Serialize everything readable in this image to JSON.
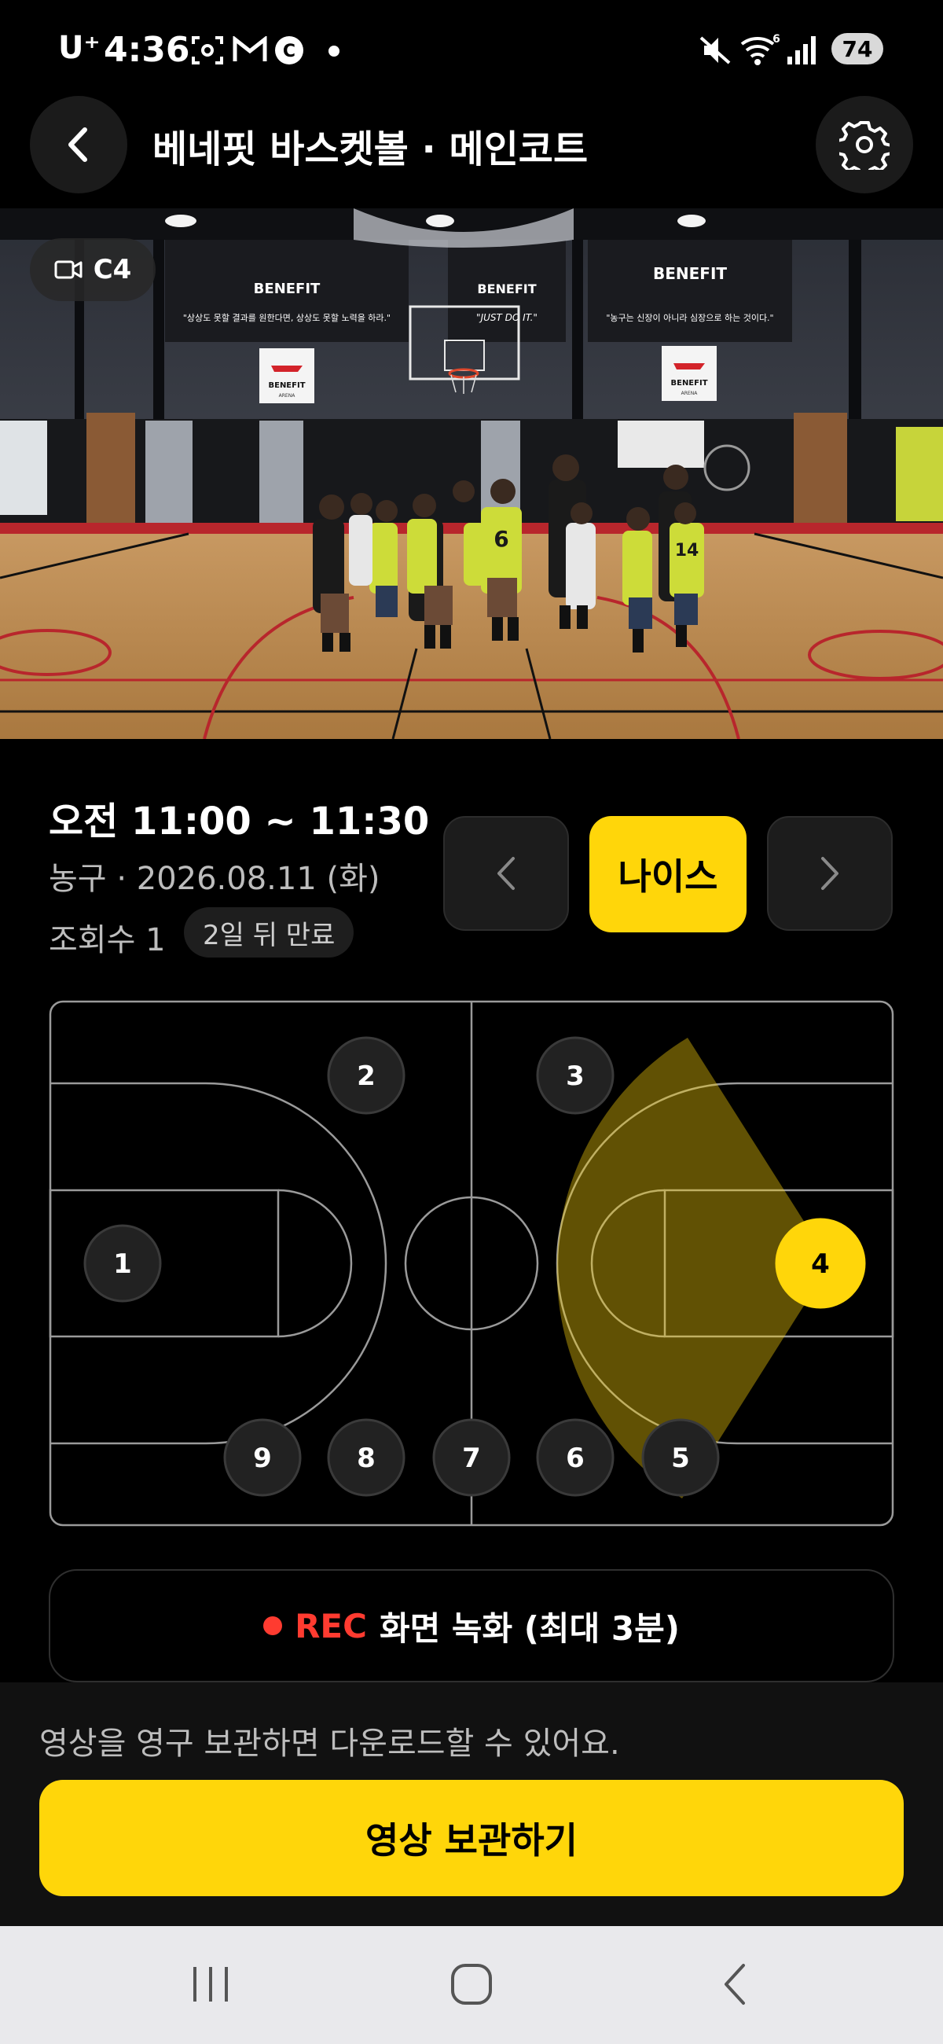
{
  "status_bar": {
    "carrier": "U⁺",
    "time": "4:36",
    "battery": "74",
    "icons": [
      "screenshot-icon",
      "gmail-icon",
      "c-app-icon",
      "dot-icon",
      "mute-icon",
      "wifi-icon",
      "signal-icon"
    ],
    "wifi_badge": "6"
  },
  "header": {
    "title": "베네핏 바스켓볼 · 메인코트",
    "back_icon": "back-arrow-icon",
    "settings_icon": "gear-icon"
  },
  "video": {
    "camera_label": "C4",
    "camera_icon": "video-camera-icon",
    "banners": [
      "\"상상도 못할 결과를 원한다면, 상상도 못할 노력을 하라.\"",
      "\"JUST DO IT.\"",
      "\"농구는 신장이 아니라 심장으로 하는 것이다.\""
    ],
    "brand": "BENEFIT",
    "brand_sub": "ARENA",
    "jersey_numbers": [
      "6",
      "14"
    ]
  },
  "info": {
    "time_range": "오전 11:00 ~ 11:30",
    "meta": "농구 · 2026.08.11 (화)",
    "views": "조회수 1",
    "expire": "2일 뒤 만료",
    "prev_icon": "chevron-left-icon",
    "next_icon": "chevron-right-icon",
    "nice_label": "나이스"
  },
  "court": {
    "positions": [
      {
        "label": "1",
        "selected": false
      },
      {
        "label": "2",
        "selected": false
      },
      {
        "label": "3",
        "selected": false
      },
      {
        "label": "4",
        "selected": true
      },
      {
        "label": "5",
        "selected": false
      },
      {
        "label": "6",
        "selected": false
      },
      {
        "label": "7",
        "selected": false
      },
      {
        "label": "8",
        "selected": false
      },
      {
        "label": "9",
        "selected": false
      }
    ],
    "colors": {
      "line": "#9a9a9a",
      "selected": "#ffd60a",
      "marker": "#222222"
    }
  },
  "rec": {
    "tag": "REC",
    "label": "화면 녹화 (최대 3분)"
  },
  "sheet": {
    "note": "영상을 영구 보관하면 다운로드할 수 있어요.",
    "save_label": "영상 보관하기"
  },
  "system_nav": {
    "icons": [
      "recent-apps-icon",
      "home-icon",
      "system-back-icon"
    ]
  },
  "colors": {
    "accent": "#ffd60a",
    "rec": "#ff3b30",
    "background": "#000000"
  }
}
